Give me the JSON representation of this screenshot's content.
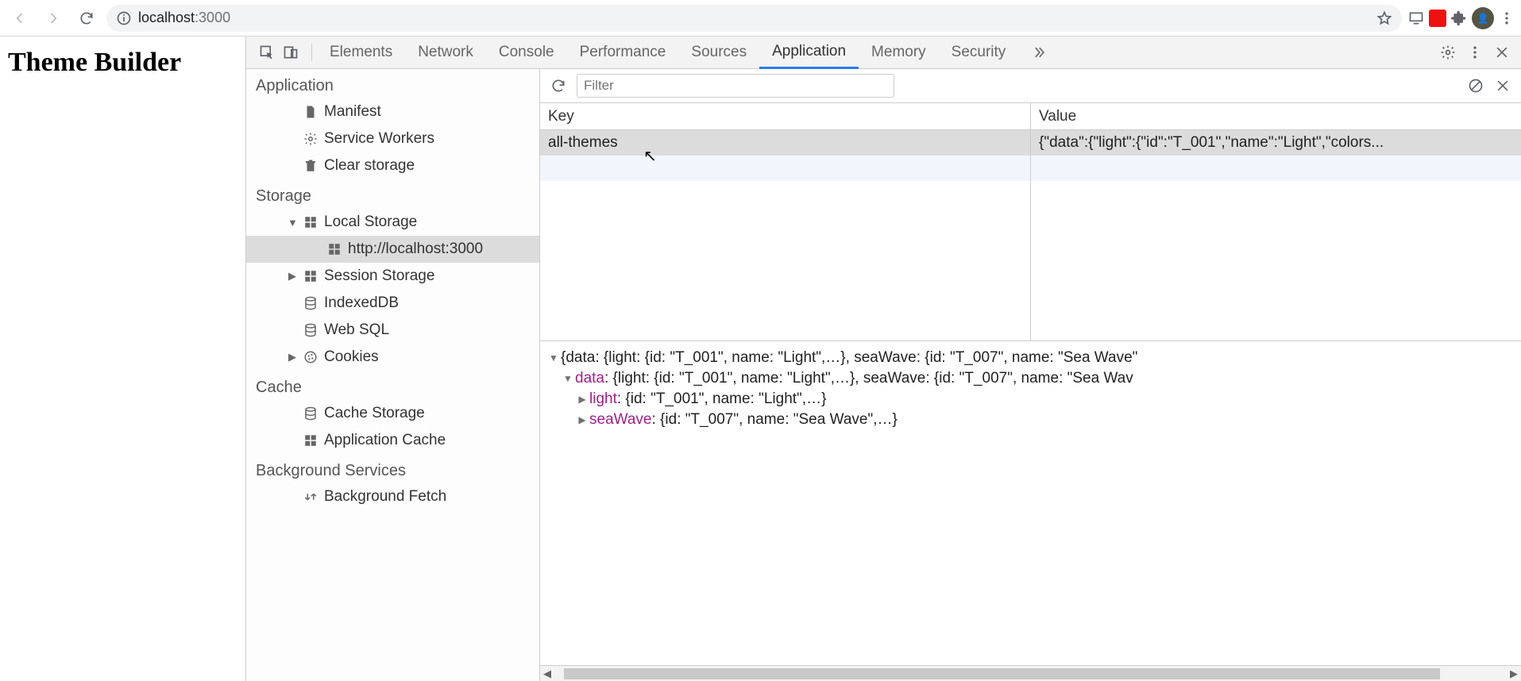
{
  "browser": {
    "url_scheme_dim": "localhost",
    "url_rest": ":3000"
  },
  "page_heading": "Theme Builder",
  "devtools_tabs": [
    "Elements",
    "Network",
    "Console",
    "Performance",
    "Sources",
    "Application",
    "Memory",
    "Security"
  ],
  "devtools_active_tab": "Application",
  "filter_placeholder": "Filter",
  "side": {
    "groups": [
      {
        "title": "Application",
        "items": [
          {
            "icon": "file",
            "label": "Manifest"
          },
          {
            "icon": "gear",
            "label": "Service Workers"
          },
          {
            "icon": "trash",
            "label": "Clear storage"
          }
        ]
      },
      {
        "title": "Storage",
        "items": [
          {
            "icon": "grid",
            "label": "Local Storage",
            "tw": "down",
            "children": [
              {
                "icon": "grid",
                "label": "http://localhost:3000",
                "selected": true
              }
            ]
          },
          {
            "icon": "grid",
            "label": "Session Storage",
            "tw": "right"
          },
          {
            "icon": "db",
            "label": "IndexedDB"
          },
          {
            "icon": "db",
            "label": "Web SQL"
          },
          {
            "icon": "cookie",
            "label": "Cookies",
            "tw": "right"
          }
        ]
      },
      {
        "title": "Cache",
        "items": [
          {
            "icon": "db",
            "label": "Cache Storage"
          },
          {
            "icon": "grid",
            "label": "Application Cache"
          }
        ]
      },
      {
        "title": "Background Services",
        "items": [
          {
            "icon": "sync",
            "label": "Background Fetch"
          }
        ]
      }
    ]
  },
  "ls_table": {
    "headers": [
      "Key",
      "Value"
    ],
    "rows": [
      {
        "key": "all-themes",
        "value": "{\"data\":{\"light\":{\"id\":\"T_001\",\"name\":\"Light\",\"colors..."
      }
    ]
  },
  "preview_lines": [
    {
      "tw": "down",
      "indent": 0,
      "text": "{data: {light: {id: \"T_001\", name: \"Light\",…}, seaWave: {id: \"T_007\", name: \"Sea Wave\""
    },
    {
      "tw": "down",
      "indent": 1,
      "key": "data",
      "text": ": {light: {id: \"T_001\", name: \"Light\",…}, seaWave: {id: \"T_007\", name: \"Sea Wav"
    },
    {
      "tw": "right",
      "indent": 2,
      "key": "light",
      "text": ": {id: \"T_001\", name: \"Light\",…}"
    },
    {
      "tw": "right",
      "indent": 2,
      "key": "seaWave",
      "text": ": {id: \"T_007\", name: \"Sea Wave\",…}"
    }
  ]
}
